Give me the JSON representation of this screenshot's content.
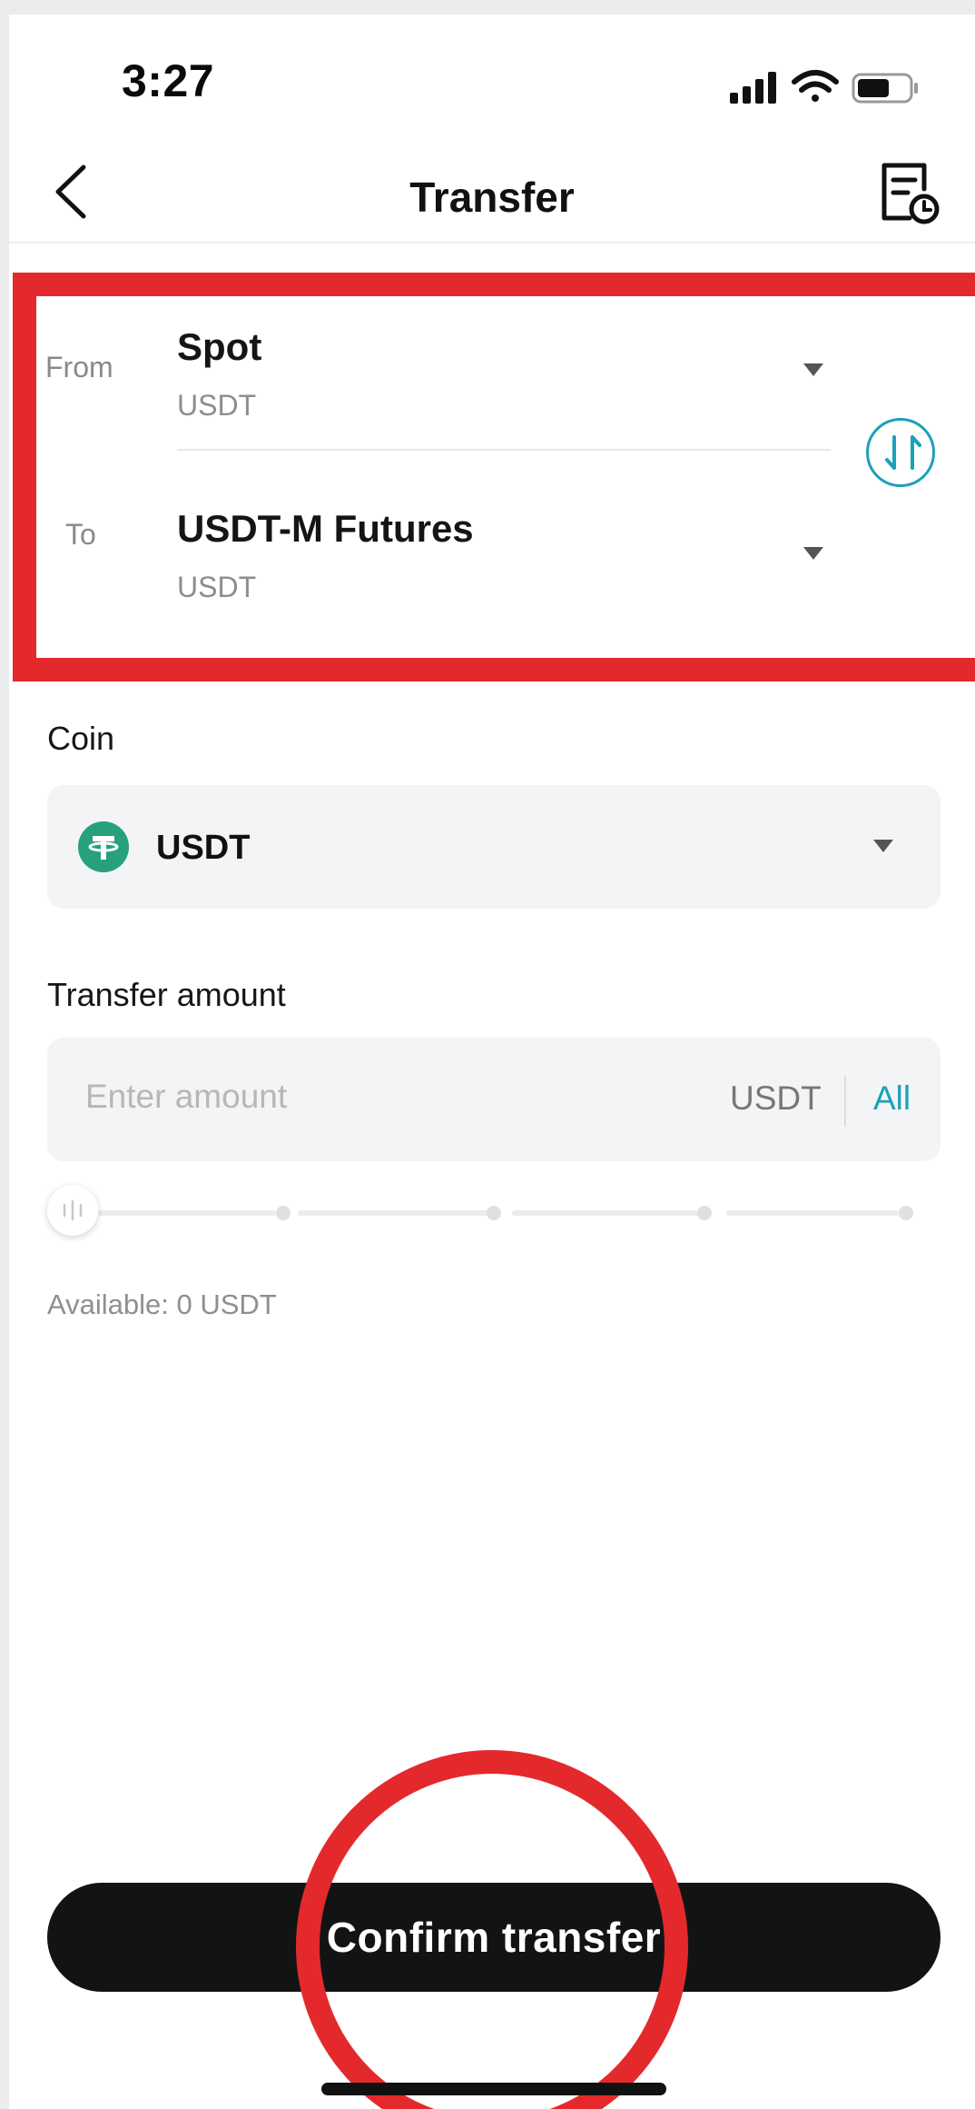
{
  "status_bar": {
    "time": "3:27"
  },
  "header": {
    "title": "Transfer"
  },
  "transfer": {
    "from_label": "From",
    "to_label": "To",
    "from_account": {
      "name": "Spot",
      "currency": "USDT"
    },
    "to_account": {
      "name": "USDT-M Futures",
      "currency": "USDT"
    }
  },
  "coin": {
    "label": "Coin",
    "selected": "USDT"
  },
  "amount": {
    "label": "Transfer amount",
    "placeholder": "Enter amount",
    "unit": "USDT",
    "all_label": "All",
    "available": "Available: 0 USDT",
    "slider_percent": 0
  },
  "actions": {
    "confirm_label": "Confirm transfer"
  },
  "colors": {
    "accent": "#1aa1b8",
    "highlight": "#e4292d",
    "tether": "#26a17b",
    "button": "#121414"
  }
}
